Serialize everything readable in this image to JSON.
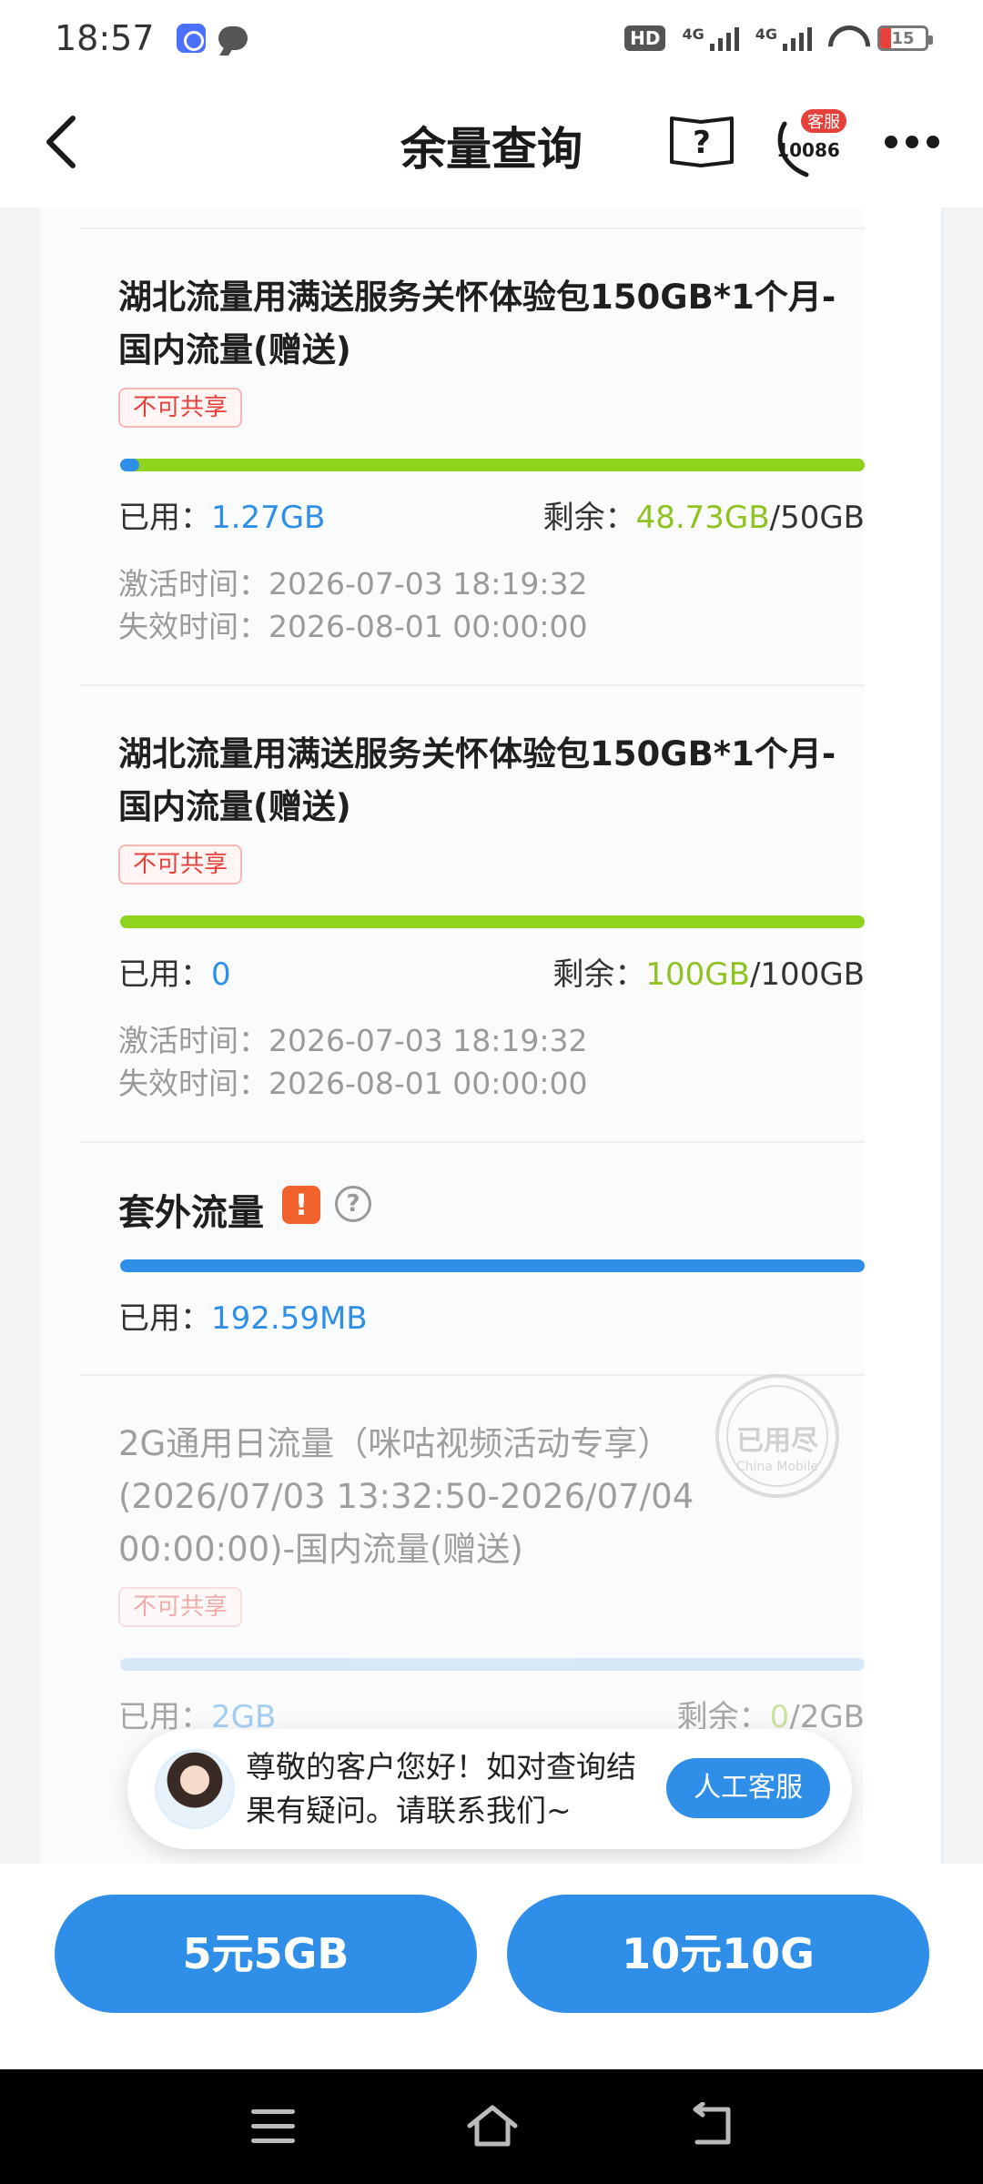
{
  "status": {
    "time": "18:57",
    "hd": "HD",
    "net1": "4G",
    "net2": "4G",
    "battery": "15"
  },
  "header": {
    "title": "余量查询",
    "help_mark": "?",
    "cs_badge": "客服",
    "cs_number": "10086"
  },
  "packages": [
    {
      "title": "湖北流量用满送服务关怀体验包150GB*1个月-国内流量(赠送)",
      "tag": "不可共享",
      "used_label": "已用：",
      "used": "1.27GB",
      "remain_label": "剩余：",
      "remain": "48.73GB",
      "total": "/50GB",
      "used_fraction": 0.0254,
      "activate": "激活时间：2026-07-03 18:19:32",
      "expire": "失效时间：2026-08-01 00:00:00"
    },
    {
      "title": "湖北流量用满送服务关怀体验包150GB*1个月-国内流量(赠送)",
      "tag": "不可共享",
      "used_label": "已用：",
      "used": "0",
      "remain_label": "剩余：",
      "remain": "100GB",
      "total": "/100GB",
      "used_fraction": 0,
      "activate": "激活时间：2026-07-03 18:19:32",
      "expire": "失效时间：2026-08-01 00:00:00"
    }
  ],
  "extra": {
    "title": "套外流量",
    "warn_mark": "!",
    "help_mark": "?",
    "used_label": "已用：",
    "used": "192.59MB",
    "used_fraction": 1
  },
  "expired_package": {
    "title": "2G通用日流量（咪咕视频活动专享）(2026/07/03 13:32:50-2026/07/04 00:00:00)-国内流量(赠送)",
    "tag": "不可共享",
    "used_label": "已用：",
    "used": "2GB",
    "remain_label": "剩余：",
    "remain": "0",
    "total": "/2GB",
    "stamp": "已用尽",
    "stamp_sub": "China Mobile"
  },
  "service_bubble": {
    "text": "尊敬的客户您好！如对查询结果有疑问。请联系我们~",
    "button": "人工客服"
  },
  "bottom": {
    "btn1": "5元5GB",
    "btn2": "10元10G"
  },
  "colors": {
    "primary": "#2f8fe8",
    "remain_green": "#8fc31f",
    "tag_red": "#e5403a",
    "warn_orange": "#f2622d"
  }
}
